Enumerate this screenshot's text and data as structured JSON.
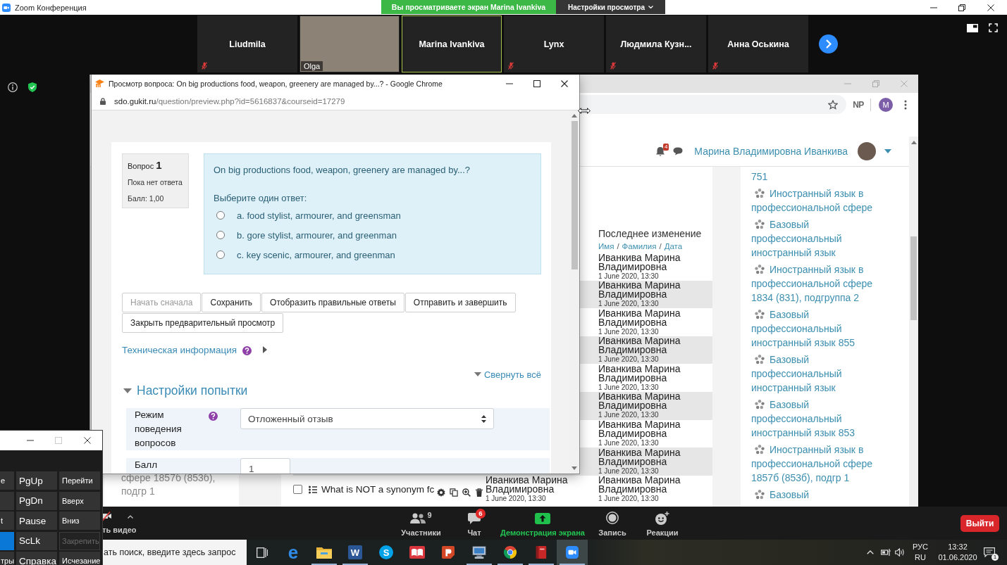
{
  "zoom": {
    "title": "Zoom Конференция",
    "banner": "Вы просматриваете экран Marina Ivankiva",
    "view_menu": "Настройки просмотра"
  },
  "participants": [
    {
      "name": "Liudmila",
      "kind": "name",
      "muted": true,
      "active": false
    },
    {
      "name": "Olga",
      "kind": "video",
      "muted": false,
      "active": false
    },
    {
      "name": "Marina Ivankiva",
      "kind": "name",
      "muted": false,
      "active": true
    },
    {
      "name": "Lynx",
      "kind": "name",
      "muted": true,
      "active": false
    },
    {
      "name": "Людмила Кузн...",
      "kind": "name",
      "muted": true,
      "active": false
    },
    {
      "name": "Анна Оськина",
      "kind": "name",
      "muted": true,
      "active": false
    }
  ],
  "main_browser": {
    "extension": "NP",
    "profile": "M",
    "navbar": {
      "notifications": "4",
      "user": "Марина Владимировна Иванкива"
    },
    "side_link": "сфере 1857б (853б), подгр 1",
    "table": {
      "header": "Последнее изменение",
      "sort_links": [
        "Имя",
        "Фамилия",
        "Дата"
      ],
      "separator": "/",
      "rows": [
        {
          "modified_by": "Иванкива Марина Владимировна",
          "modified_date": "1 June 2020, 13:30"
        },
        {
          "modified_by": "Иванкива Марина Владимировна",
          "modified_date": "1 June 2020, 13:30"
        },
        {
          "modified_by": "Иванкива Марина Владимировна",
          "modified_date": "1 June 2020, 13:30"
        },
        {
          "modified_by": "Иванкива Марина Владимировна",
          "modified_date": "1 June 2020, 13:30"
        },
        {
          "modified_by": "Иванкива Марина Владимировна",
          "modified_date": "1 June 2020, 13:30"
        },
        {
          "modified_by": "Иванкива Марина Владимировна",
          "modified_date": "1 June 2020, 13:30"
        },
        {
          "modified_by": "Иванкива Марина Владимировна",
          "modified_date": "1 June 2020, 13:30"
        },
        {
          "modified_by": "Иванкива Марина Владимировна",
          "modified_date": "1 June 2020, 13:30"
        },
        {
          "checked": false,
          "question": "What is NOT a synonym fc",
          "created_by": "Иванкива Марина Владимировна",
          "created_date": "1 June 2020, 13:30",
          "modified_by": "Иванкива Марина Владимировна",
          "modified_date": "1 June 2020, 13:30"
        }
      ]
    },
    "courses": {
      "tail": "751",
      "items": [
        "Иностранный язык в профессиональной сфере",
        "Базовый профессиональный иностранный язык",
        "Иностранный язык в профессиональной сфере 1834 (831), подгруппа 2",
        "Базовый профессиональный иностранный язык 855",
        "Базовый профессиональный иностранный язык",
        "Базовый профессиональный иностранный язык 853",
        "Иностранный язык в профессиональной сфере 1857б (853б), подгр 1",
        "Базовый"
      ]
    }
  },
  "popup": {
    "title": "Просмотр вопроса: On big productions food, weapon, greenery are managed by...? - Google Chrome",
    "url_host": "sdo.gukit.ru",
    "url_path": "/question/preview.php?id=5616837&courseid=17279",
    "info": {
      "label": "Вопрос **1**",
      "status": "Пока нет ответа",
      "mark": "Балл: 1,00"
    },
    "question": {
      "text": "On big productions food, weapon, greenery are managed by...?",
      "prompt": "Выберите один ответ:",
      "options": [
        {
          "label": "a. food stylist, armourer, and greensman",
          "selected": false
        },
        {
          "label": "b. gore stylist, armourer, and greenman",
          "selected": false
        },
        {
          "label": "c. key scenic, armourer, and greenman",
          "selected": false
        }
      ]
    },
    "buttons": [
      {
        "label": "Начать сначала",
        "disabled": true
      },
      {
        "label": "Сохранить",
        "disabled": false
      },
      {
        "label": "Отобразить правильные ответы",
        "disabled": false
      },
      {
        "label": "Отправить и завершить",
        "disabled": false
      },
      {
        "label": "Закрыть предварительный просмотр",
        "disabled": false
      }
    ],
    "tech_info": {
      "label": "Техническая информация",
      "expanded": false
    },
    "collapse_all": "Свернуть всё",
    "section": {
      "title": "Настройки попытки",
      "expanded": true,
      "fields": [
        {
          "label": "Режим поведения вопросов",
          "kind": "select",
          "value": "Отложенный отзыв",
          "help": true
        },
        {
          "label": "Балл",
          "kind": "input",
          "value": "1",
          "help": false
        }
      ]
    }
  },
  "keyboard": {
    "keys": [
      {
        "label": "e",
        "highlighted": false,
        "disabled": false
      },
      {
        "label": "PgUp",
        "highlighted": false,
        "disabled": false
      },
      {
        "label": "Перейти",
        "highlighted": false,
        "disabled": false
      },
      {
        "highlighted": false,
        "disabled": false
      },
      {
        "label": "PgDn",
        "highlighted": false,
        "disabled": false
      },
      {
        "label": "Вверх",
        "highlighted": false,
        "disabled": false
      },
      {
        "label": "t",
        "highlighted": false,
        "disabled": false
      },
      {
        "label": "Pause",
        "highlighted": false,
        "disabled": false
      },
      {
        "label": "Вниз",
        "highlighted": false,
        "disabled": false
      },
      {
        "highlighted": true,
        "disabled": false
      },
      {
        "label": "ScLk",
        "highlighted": false,
        "disabled": false
      },
      {
        "label": "Закрепить",
        "highlighted": false,
        "disabled": true
      },
      {
        "label": "тры",
        "highlighted": false,
        "disabled": false
      },
      {
        "label": "Справка",
        "highlighted": false,
        "disabled": false
      },
      {
        "label": "Исчезание",
        "highlighted": false,
        "disabled": false
      }
    ]
  },
  "meeting_toolbar": {
    "video_label": "ть видео",
    "items": [
      {
        "label": "Участники",
        "kind": "participants",
        "count": "9"
      },
      {
        "label": "Чат",
        "kind": "chat",
        "badge": "6"
      },
      {
        "label": "Демонстрация экрана",
        "kind": "share"
      },
      {
        "label": "Запись",
        "kind": "record"
      },
      {
        "label": "Реакции",
        "kind": "reactions"
      }
    ],
    "leave": "Выйти"
  },
  "taskbar": {
    "search": "ать поиск, введите здесь запрос",
    "apps": [
      {
        "kind": "taskview",
        "running": false,
        "active": false
      },
      {
        "kind": "edge",
        "glyph": "e",
        "running": false,
        "active": false
      },
      {
        "kind": "explorer",
        "running": true,
        "active": false
      },
      {
        "kind": "word",
        "glyph": "W",
        "running": true,
        "active": false
      },
      {
        "kind": "skype",
        "glyph": "S",
        "running": false,
        "active": false
      },
      {
        "kind": "reader",
        "running": false,
        "active": false
      },
      {
        "kind": "presenter",
        "running": false,
        "active": false
      },
      {
        "kind": "remote",
        "running": true,
        "active": false
      },
      {
        "kind": "chrome",
        "running": true,
        "active": false
      },
      {
        "kind": "book",
        "running": true,
        "active": false
      },
      {
        "kind": "zoom",
        "running": true,
        "active": true
      }
    ],
    "tray": {
      "language": "РУС",
      "layout": "RU",
      "time": "13:32",
      "date": "01.06.2020",
      "notifications": "1"
    }
  }
}
